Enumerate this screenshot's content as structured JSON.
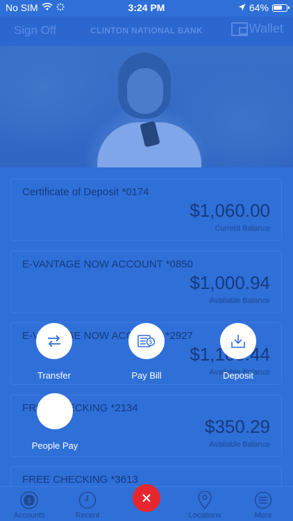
{
  "status": {
    "carrier": "No SIM",
    "time": "3:24 PM",
    "battery": "64%"
  },
  "nav": {
    "sign_off": "Sign Off",
    "bank_name": "CLINTON NATIONAL BANK",
    "wallet": "Wallet"
  },
  "accounts": [
    {
      "name": "Certificate of Deposit *0174",
      "amount": "$1,060.00",
      "label": "Current Balance"
    },
    {
      "name": "E-VANTAGE NOW ACCOUNT *0850",
      "amount": "$1,000.94",
      "label": "Available Balance"
    },
    {
      "name": "E-VANTAGE NOW ACCOUNT *2927",
      "amount": "$1,100.44",
      "label": "Available Balance"
    },
    {
      "name": "FREE CHECKING *2134",
      "amount": "$350.29",
      "label": "Available Balance"
    },
    {
      "name": "FREE CHECKING *3613",
      "amount": "",
      "label": ""
    }
  ],
  "actions": {
    "transfer": "Transfer",
    "pay_bill": "Pay Bill",
    "deposit": "Deposit",
    "people_pay": "People Pay"
  },
  "tabs": {
    "accounts": "Accounts",
    "recent": "Recent",
    "locations": "Locations",
    "more": "More"
  },
  "colors": {
    "primary": "#2f6fd8",
    "text_dim": "#153a7e",
    "close_button": "#e8262e"
  }
}
